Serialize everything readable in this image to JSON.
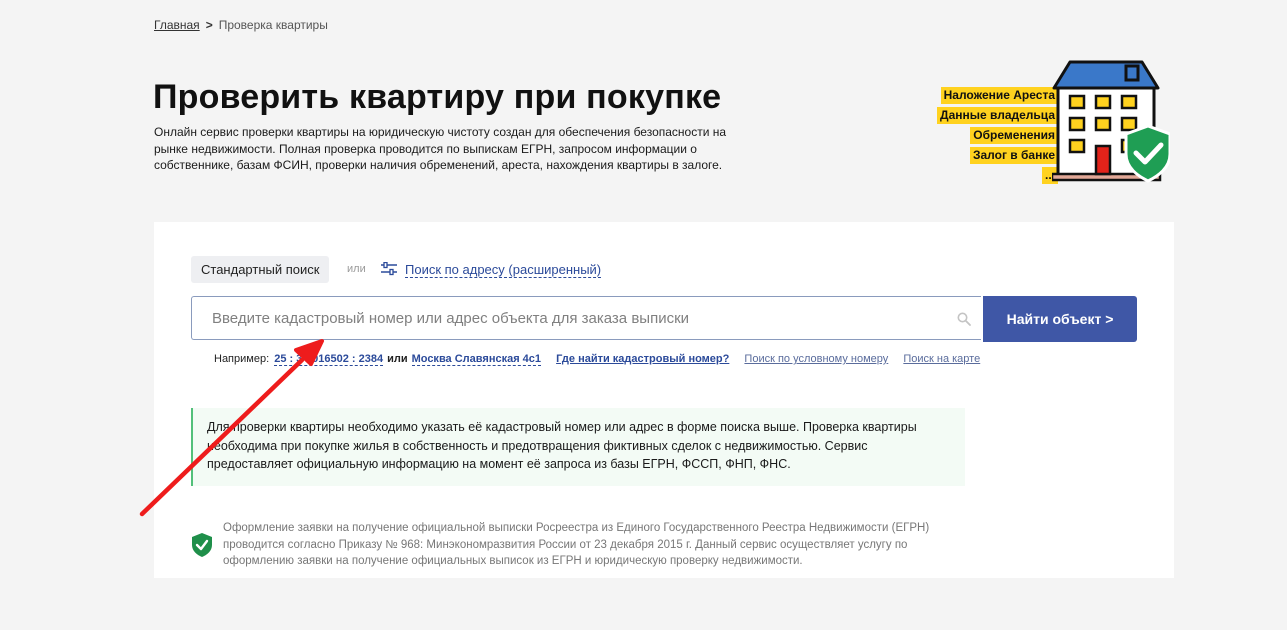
{
  "breadcrumb": {
    "home": "Главная",
    "separator": ">",
    "current": "Проверка квартиры"
  },
  "page": {
    "title": "Проверить квартиру при покупке",
    "description": "Онлайн сервис проверки квартиры на юридическую чистоту создан для обеспечения безопасности на рынке недвижимости. Полная проверка проводится по выпискам ЕГРН, запросом информации о собственнике, базам ФСИН, проверки наличия обременений, ареста, нахождения квартиры в залоге."
  },
  "badge": {
    "tags": [
      "Наложение Ареста",
      "Данные владельца",
      "Обременения",
      "Залог в банке",
      "..."
    ],
    "highlight_color": "#ffd21f",
    "icon": "building-with-shield-check"
  },
  "search": {
    "tab_standard": "Стандартный поиск",
    "or_text": "или",
    "tab_advanced": "Поиск по адресу (расширенный)",
    "placeholder": "Введите кадастровый номер или адрес объекта для заказа выписки",
    "button": "Найти объект >",
    "examples": {
      "label": "Например:",
      "cadastral": "25 : 3 : 016502 : 2384",
      "or": "или",
      "address": "Москва Славянская 4с1",
      "help": "Где найти кадастровый номер?",
      "conditional": "Поиск по условному номеру",
      "map": "Поиск на карте"
    }
  },
  "info": "Для проверки квартиры необходимо указать её кадастровый номер или адрес в форме поиска выше. Проверка квартиры необходима при покупке жилья в собственность и предотвращения фиктивных сделок с недвижимостью. Сервис предоставляет официальную информацию на момент её запроса из базы ЕГРН, ФССП, ФНП, ФНС.",
  "legal": "Оформление заявки на получение официальной выписки Росреестра из Единого Государственного Реестра Недвижимости (ЕГРН) проводится согласно Приказу № 968: Минэкономразвития России от 23 декабря 2015 г. Данный сервис осуществляет услугу по оформлению заявки на получение официальных выписок из ЕГРН и юридическую проверку недвижимости.",
  "colors": {
    "primary": "#3f57a6",
    "link": "#2b4a9a",
    "success": "#53c07a",
    "annotation_arrow": "#ee1c1c"
  }
}
